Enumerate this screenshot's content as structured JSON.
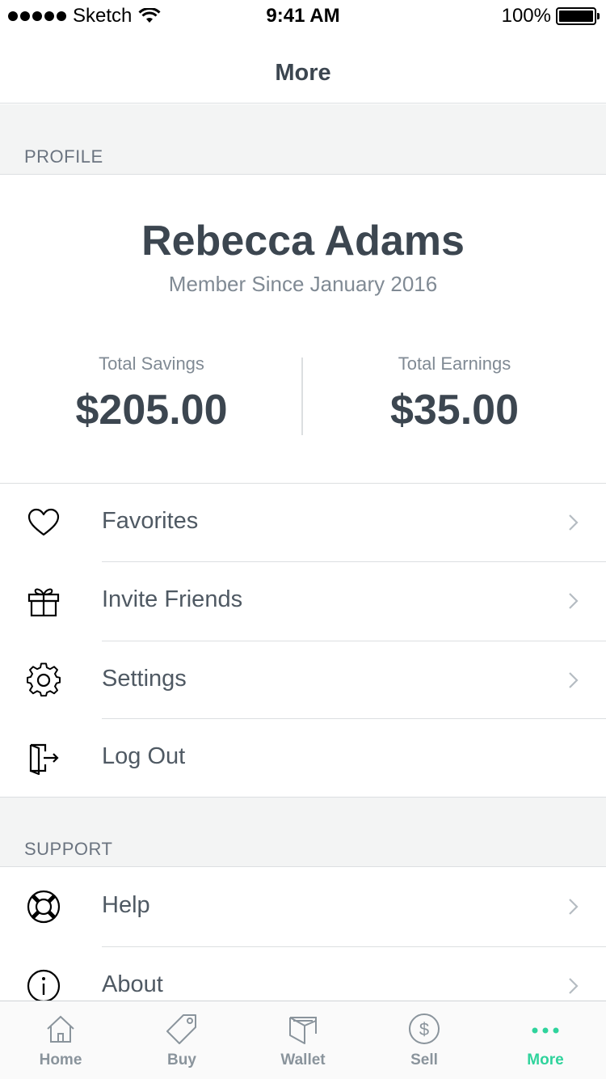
{
  "status_bar": {
    "carrier": "Sketch",
    "time": "9:41 AM",
    "battery": "100%"
  },
  "nav": {
    "title": "More"
  },
  "profile_section": {
    "title": "PROFILE"
  },
  "profile": {
    "name": "Rebecca Adams",
    "member_since": "Member Since January 2016"
  },
  "stats": {
    "savings_label": "Total Savings",
    "savings_value": "$205.00",
    "earnings_label": "Total Earnings",
    "earnings_value": "$35.00"
  },
  "menu": [
    {
      "label": "Favorites",
      "icon": "heart-icon"
    },
    {
      "label": "Invite Friends",
      "icon": "gift-icon"
    },
    {
      "label": "Settings",
      "icon": "gear-icon"
    },
    {
      "label": "Log Out",
      "icon": "logout-icon"
    }
  ],
  "support_section": {
    "title": "SUPPORT"
  },
  "support": [
    {
      "label": "Help",
      "icon": "lifebuoy-icon"
    },
    {
      "label": "About",
      "icon": "info-icon"
    }
  ],
  "tabs": [
    {
      "label": "Home",
      "icon": "home-icon"
    },
    {
      "label": "Buy",
      "icon": "tag-icon"
    },
    {
      "label": "Wallet",
      "icon": "wallet-icon"
    },
    {
      "label": "Sell",
      "icon": "dollar-icon"
    },
    {
      "label": "More",
      "icon": "more-icon"
    }
  ],
  "colors": {
    "accent": "#2fd39c",
    "text": "#3c4650",
    "muted": "#808a94",
    "section_bg": "#f3f4f4"
  }
}
